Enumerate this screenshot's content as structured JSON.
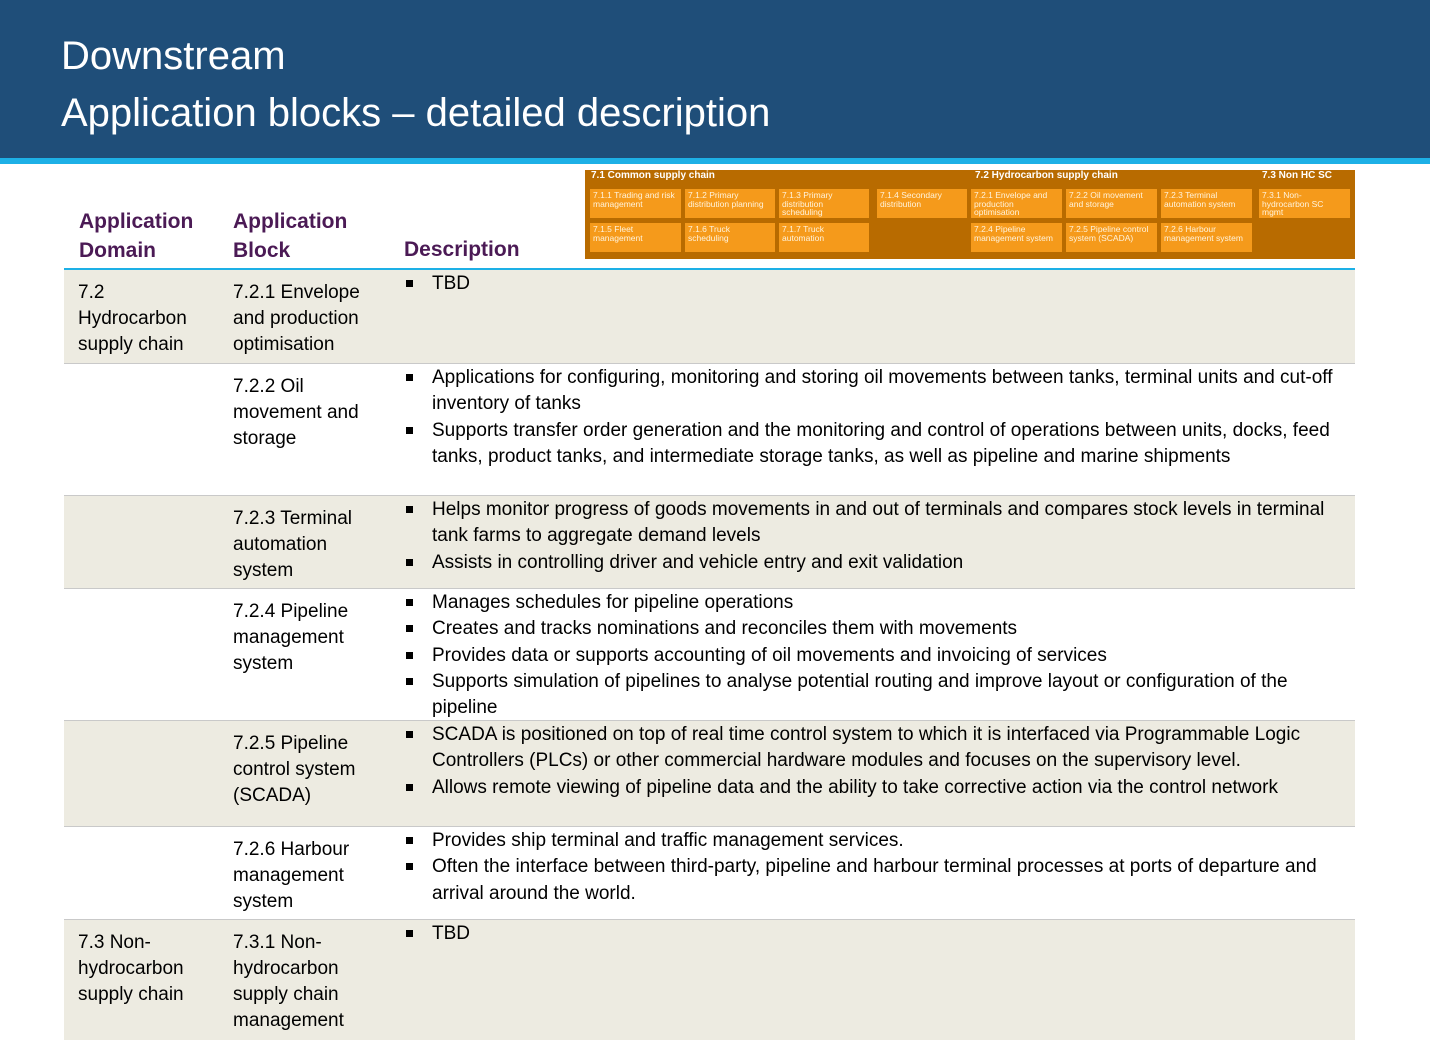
{
  "header": {
    "title_line1": "Downstream",
    "title_line2": "Application blocks – detailed description"
  },
  "columns": {
    "domain": "Application Domain",
    "block": "Application Block",
    "description": "Description"
  },
  "minimap": {
    "group_titles": [
      "7.1 Common supply chain",
      "7.2 Hydrocarbon supply chain",
      "7.3 Non HC SC"
    ],
    "boxes": [
      "7.1.1 Trading and risk management",
      "7.1.2 Primary distribution planning",
      "7.1.3 Primary distribution scheduling",
      "7.1.4 Secondary distribution",
      "7.2.1 Envelope and production optimisation",
      "7.2.2 Oil movement and storage",
      "7.2.3 Terminal automation system",
      "7.3.1 Non-hydrocarbon SC mgmt",
      "7.1.5 Fleet management",
      "7.1.6 Truck scheduling",
      "7.1.7 Truck automation",
      "7.2.4 Pipeline management system",
      "7.2.5 Pipeline control system (SCADA)",
      "7.2.6 Harbour management system"
    ],
    "colors": {
      "background": "#b86b00",
      "box": "#f59a1b"
    }
  },
  "rows": [
    {
      "domain": "7.2 Hydrocarbon supply chain",
      "block": "7.2.1 Envelope and production optimisation",
      "bullets": [
        "TBD"
      ]
    },
    {
      "domain": "",
      "block": "7.2.2 Oil movement and storage",
      "bullets": [
        "Applications for configuring, monitoring and storing oil movements between tanks, terminal units and cut-off inventory of tanks",
        "Supports transfer order generation and the monitoring and control of operations between units, docks, feed tanks, product tanks, and intermediate storage tanks, as well as pipeline and marine shipments"
      ]
    },
    {
      "domain": "",
      "block": "7.2.3 Terminal automation system",
      "bullets": [
        "Helps monitor progress of goods movements in and out of terminals and compares stock levels in terminal tank farms to aggregate demand levels",
        "Assists in controlling driver and vehicle entry and exit validation"
      ]
    },
    {
      "domain": "",
      "block": "7.2.4 Pipeline management system",
      "bullets": [
        "Manages schedules for pipeline operations",
        "Creates and tracks nominations and reconciles them with movements",
        "Provides data or supports accounting of oil movements and invoicing of services",
        "Supports simulation of pipelines to analyse potential routing and improve layout or configuration of the pipeline"
      ]
    },
    {
      "domain": "",
      "block": "7.2.5 Pipeline control system (SCADA)",
      "bullets": [
        "SCADA is positioned on top of real time control system to which it is interfaced via Programmable Logic Controllers (PLCs) or other commercial hardware modules and focuses on the supervisory level.",
        "Allows remote viewing of pipeline data and the ability to take corrective action via the control network"
      ]
    },
    {
      "domain": "",
      "block": "7.2.6 Harbour management system",
      "bullets": [
        "Provides ship terminal and traffic management services.",
        "Often the interface between third-party, pipeline and harbour terminal processes at ports of departure and arrival around the world."
      ]
    },
    {
      "domain": "7.3 Non-hydrocarbon supply chain",
      "block": "7.3.1 Non-hydrocarbon supply chain management",
      "bullets": [
        "TBD"
      ]
    }
  ]
}
